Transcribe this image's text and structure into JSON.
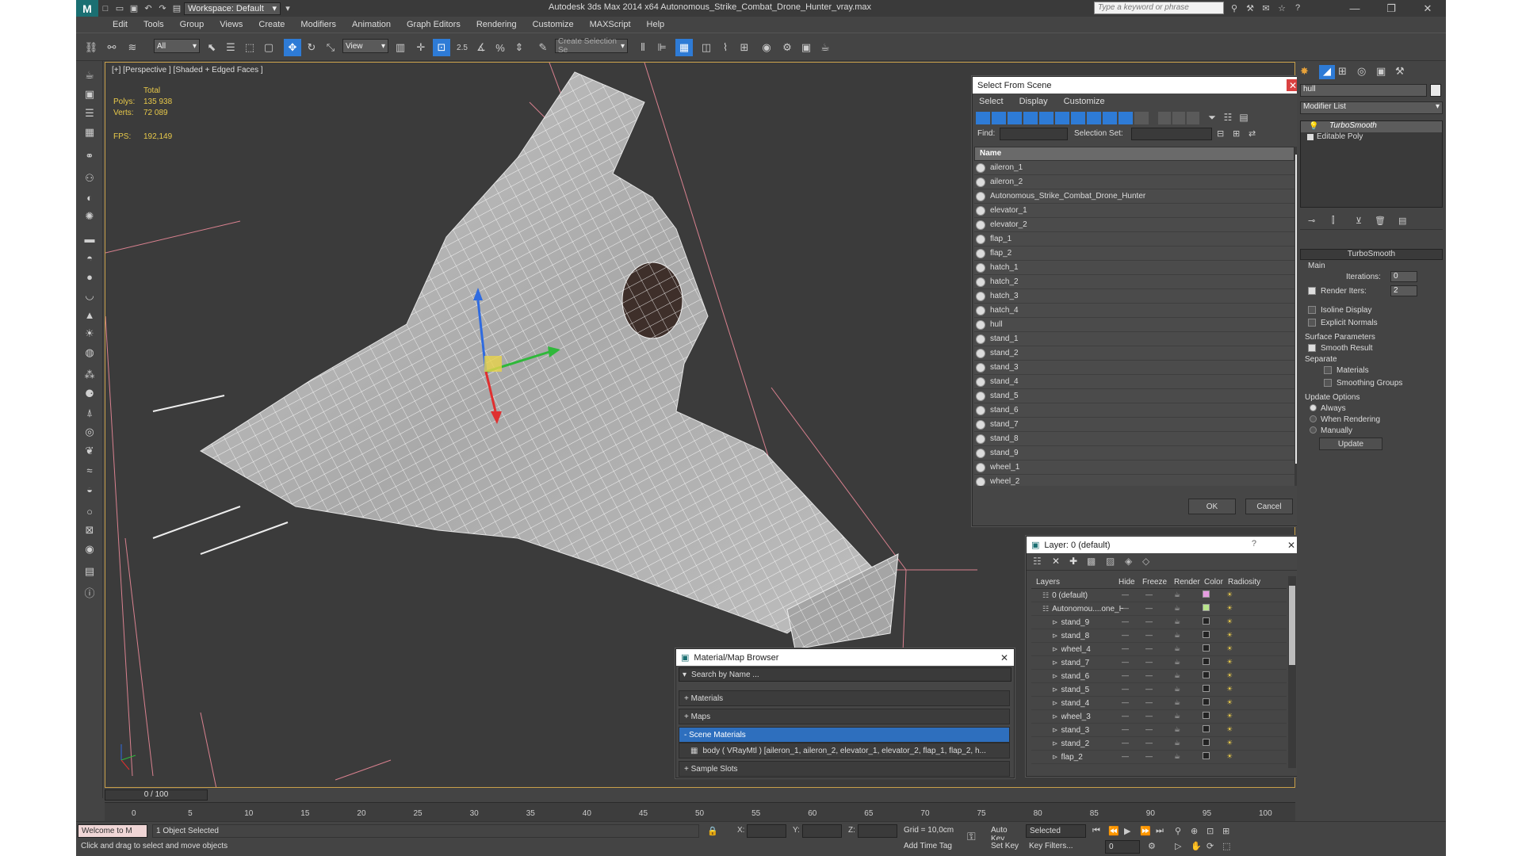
{
  "window": {
    "app_title": "Autodesk 3ds Max  2014 x64     Autonomous_Strike_Combat_Drone_Hunter_vray.max",
    "workspace": "Workspace: Default",
    "search_placeholder": "Type a keyword or phrase"
  },
  "menu": [
    "Edit",
    "Tools",
    "Group",
    "Views",
    "Create",
    "Modifiers",
    "Animation",
    "Graph Editors",
    "Rendering",
    "Customize",
    "MAXScript",
    "Help"
  ],
  "toolbar": {
    "filter_dd": "All",
    "refcoord_dd": "View",
    "snap_label": "2.5",
    "selset_placeholder": "Create Selection Se"
  },
  "viewport": {
    "label": "[+] [Perspective ] [Shaded + Edged Faces ]",
    "stats": {
      "total_label": "Total",
      "polys_label": "Polys:",
      "polys_value": "135 938",
      "verts_label": "Verts:",
      "verts_value": "72 089",
      "fps_label": "FPS:",
      "fps_value": "192,149"
    }
  },
  "select_from_scene": {
    "title": "Select From Scene",
    "menu": [
      "Select",
      "Display",
      "Customize"
    ],
    "find_label": "Find:",
    "selset_label": "Selection Set:",
    "column_name": "Name",
    "items": [
      "aileron_1",
      "aileron_2",
      "Autonomous_Strike_Combat_Drone_Hunter",
      "elevator_1",
      "elevator_2",
      "flap_1",
      "flap_2",
      "hatch_1",
      "hatch_2",
      "hatch_3",
      "hatch_4",
      "hull",
      "stand_1",
      "stand_2",
      "stand_3",
      "stand_4",
      "stand_5",
      "stand_6",
      "stand_7",
      "stand_8",
      "stand_9",
      "wheel_1",
      "wheel_2"
    ],
    "ok_label": "OK",
    "cancel_label": "Cancel"
  },
  "layer": {
    "title": "Layer: 0 (default)",
    "help_label": "?",
    "columns": [
      "Layers",
      "Hide",
      "Freeze",
      "Render",
      "Color",
      "Radiosity"
    ],
    "rows": [
      {
        "name": "0 (default)",
        "level": 0,
        "color": "#e59ce0"
      },
      {
        "name": "Autonomou....one_H",
        "level": 0,
        "color": "#b9e58c"
      },
      {
        "name": "stand_9",
        "level": 1,
        "color": "#222222"
      },
      {
        "name": "stand_8",
        "level": 1,
        "color": "#222222"
      },
      {
        "name": "wheel_4",
        "level": 1,
        "color": "#222222"
      },
      {
        "name": "stand_7",
        "level": 1,
        "color": "#222222"
      },
      {
        "name": "stand_6",
        "level": 1,
        "color": "#222222"
      },
      {
        "name": "stand_5",
        "level": 1,
        "color": "#222222"
      },
      {
        "name": "stand_4",
        "level": 1,
        "color": "#222222"
      },
      {
        "name": "wheel_3",
        "level": 1,
        "color": "#222222"
      },
      {
        "name": "stand_3",
        "level": 1,
        "color": "#222222"
      },
      {
        "name": "stand_2",
        "level": 1,
        "color": "#222222"
      },
      {
        "name": "flap_2",
        "level": 1,
        "color": "#222222"
      }
    ]
  },
  "material_browser": {
    "title": "Material/Map Browser",
    "search_placeholder": "Search by Name ...",
    "sections": [
      "+ Materials",
      "+ Maps",
      "- Scene Materials"
    ],
    "scene_item": "body  ( VRayMtl ) [aileron_1, aileron_2, elevator_1, elevator_2, flap_1, flap_2, h...",
    "sample_slots": "+ Sample Slots"
  },
  "command_panel": {
    "name_field": "hull",
    "modifier_list": "Modifier List",
    "stack": [
      "TurboSmooth",
      "Editable Poly"
    ],
    "rollout_title": "TurboSmooth",
    "main_label": "Main",
    "iterations_label": "Iterations:",
    "iterations_value": "0",
    "render_iters_label": "Render Iters:",
    "render_iters_value": "2",
    "isoline_label": "Isoline Display",
    "explicit_label": "Explicit Normals",
    "surface_label": "Surface Parameters",
    "smooth_label": "Smooth Result",
    "separate_label": "Separate",
    "materials_label": "Materials",
    "smoothing_label": "Smoothing Groups",
    "update_options_label": "Update Options",
    "always_label": "Always",
    "when_rendering_label": "When Rendering",
    "manually_label": "Manually",
    "update_button": "Update"
  },
  "timeline": {
    "frame_label": "0 / 100",
    "ticks": [
      "0",
      "5",
      "10",
      "15",
      "20",
      "25",
      "30",
      "35",
      "40",
      "45",
      "50",
      "55",
      "60",
      "65",
      "70",
      "75",
      "80",
      "85",
      "90",
      "95",
      "100"
    ]
  },
  "status": {
    "maxscript": "Welcome to M",
    "selected": "1 Object Selected",
    "prompt": "Click and drag to select and move objects",
    "x_label": "X:",
    "y_label": "Y:",
    "z_label": "Z:",
    "grid": "Grid = 10,0cm",
    "add_time_tag": "Add Time Tag",
    "auto_key": "Auto Key",
    "set_key": "Set Key",
    "selected_dd": "Selected",
    "key_filters": "Key Filters...",
    "frame_value": "0"
  },
  "colors": {
    "accent": "#2e7bd6",
    "viewport_border": "#c9a04a",
    "stat_yellow": "#e8c94a"
  }
}
